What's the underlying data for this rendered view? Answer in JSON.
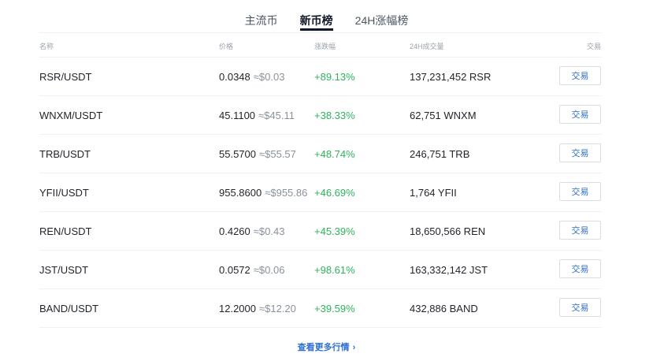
{
  "tabs": [
    {
      "label": "主流币",
      "active": false
    },
    {
      "label": "新币榜",
      "active": true
    },
    {
      "label": "24H涨幅榜",
      "active": false
    }
  ],
  "columns": {
    "pair": "名称",
    "price": "价格",
    "change": "涨跌幅",
    "volume": "24H成交量",
    "trade": "交易"
  },
  "rows": [
    {
      "pair": "RSR/USDT",
      "price": "0.0348",
      "approx": "≈$0.03",
      "change": "+89.13%",
      "volume": "137,231,452 RSR",
      "action": "交易"
    },
    {
      "pair": "WNXM/USDT",
      "price": "45.1100",
      "approx": "≈$45.11",
      "change": "+38.33%",
      "volume": "62,751 WNXM",
      "action": "交易"
    },
    {
      "pair": "TRB/USDT",
      "price": "55.5700",
      "approx": "≈$55.57",
      "change": "+48.74%",
      "volume": "246,751 TRB",
      "action": "交易"
    },
    {
      "pair": "YFII/USDT",
      "price": "955.8600",
      "approx": "≈$955.86",
      "change": "+46.69%",
      "volume": "1,764 YFII",
      "action": "交易"
    },
    {
      "pair": "REN/USDT",
      "price": "0.4260",
      "approx": "≈$0.43",
      "change": "+45.39%",
      "volume": "18,650,566 REN",
      "action": "交易"
    },
    {
      "pair": "JST/USDT",
      "price": "0.0572",
      "approx": "≈$0.06",
      "change": "+98.61%",
      "volume": "163,332,142 JST",
      "action": "交易"
    },
    {
      "pair": "BAND/USDT",
      "price": "12.2000",
      "approx": "≈$12.20",
      "change": "+39.59%",
      "volume": "432,886 BAND",
      "action": "交易"
    }
  ],
  "more_link": {
    "label": "查看更多行情",
    "icon": "chevron-right-icon"
  },
  "colors": {
    "positive": "#2db35d",
    "link": "#2f6fd0",
    "active_tab": "#111827"
  }
}
